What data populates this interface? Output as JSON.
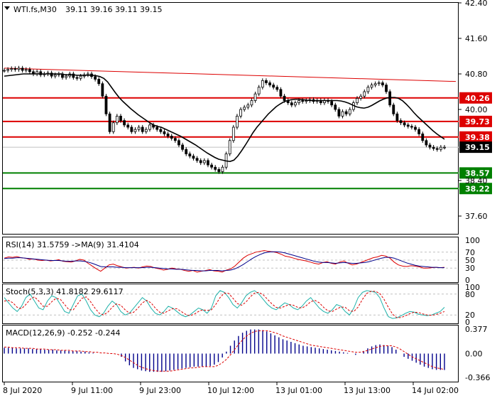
{
  "header": {
    "symbol": "WTI.fs,M30",
    "quote": "39.11 39.16 39.11 39.15"
  },
  "colors": {
    "candle": "#000000",
    "ma": "#000000",
    "resistance": "#dd0000",
    "support": "#008000",
    "current_tag": "#000000",
    "rsi": "#dd0000",
    "rsi_ma": "#00008b",
    "stoch_main": "#20b2aa",
    "stoch_signal": "#dd0000",
    "macd_hist": "#00008b",
    "macd_signal": "#dd0000"
  },
  "chart_data": [
    {
      "type": "candlestick",
      "title": "WTI.fs,M30",
      "ylim": [
        37.2,
        42.4
      ],
      "y_ticks": [
        "42.40",
        "41.60",
        "40.80",
        "40.00",
        "38.40",
        "37.60"
      ],
      "x_ticks": [
        "8 Jul 2020",
        "9 Jul 11:00",
        "9 Jul 23:00",
        "10 Jul 12:00",
        "13 Jul 01:00",
        "13 Jul 13:00",
        "14 Jul 02:00"
      ],
      "current_price": "39.15",
      "levels": {
        "resistance": [
          "40.26",
          "39.73",
          "39.38"
        ],
        "support": [
          "38.57",
          "38.22"
        ]
      },
      "trendline": {
        "from": 40.93,
        "to": 40.63
      },
      "close": [
        40.88,
        40.9,
        40.92,
        40.9,
        40.93,
        40.88,
        40.9,
        40.85,
        40.8,
        40.85,
        40.78,
        40.8,
        40.82,
        40.75,
        40.78,
        40.8,
        40.72,
        40.75,
        40.8,
        40.72,
        40.7,
        40.75,
        40.78,
        40.8,
        40.74,
        40.68,
        40.58,
        40.3,
        39.9,
        39.5,
        39.7,
        39.85,
        39.75,
        39.65,
        39.6,
        39.5,
        39.55,
        39.6,
        39.5,
        39.55,
        39.65,
        39.6,
        39.55,
        39.5,
        39.45,
        39.4,
        39.35,
        39.3,
        39.2,
        39.1,
        39.0,
        38.95,
        38.9,
        38.85,
        38.8,
        38.85,
        38.75,
        38.7,
        38.65,
        38.6,
        38.7,
        39.0,
        39.3,
        39.6,
        39.85,
        40.0,
        40.05,
        40.1,
        40.2,
        40.35,
        40.5,
        40.65,
        40.6,
        40.55,
        40.5,
        40.45,
        40.3,
        40.2,
        40.15,
        40.1,
        40.15,
        40.2,
        40.18,
        40.2,
        40.22,
        40.18,
        40.2,
        40.15,
        40.2,
        40.18,
        40.1,
        40.0,
        39.85,
        39.95,
        39.9,
        40.0,
        40.15,
        40.25,
        40.3,
        40.4,
        40.5,
        40.55,
        40.58,
        40.6,
        40.55,
        40.4,
        40.1,
        39.9,
        39.75,
        39.7,
        39.65,
        39.62,
        39.6,
        39.55,
        39.45,
        39.3,
        39.2,
        39.15,
        39.12,
        39.1,
        39.15,
        39.15
      ],
      "ma": [
        40.75,
        40.76,
        40.77,
        40.78,
        40.79,
        40.8,
        40.8,
        40.8,
        40.8,
        40.8,
        40.8,
        40.8,
        40.8,
        40.8,
        40.8,
        40.8,
        40.78,
        40.78,
        40.78,
        40.77,
        40.77,
        40.77,
        40.77,
        40.77,
        40.76,
        40.74,
        40.7,
        40.62,
        40.5,
        40.38,
        40.27,
        40.18,
        40.1,
        40.02,
        39.95,
        39.88,
        39.82,
        39.76,
        39.7,
        39.65,
        39.62,
        39.6,
        39.56,
        39.52,
        39.48,
        39.44,
        39.4,
        39.35,
        39.3,
        39.25,
        39.2,
        39.14,
        39.08,
        39.02,
        38.97,
        38.92,
        38.88,
        38.86,
        38.84,
        38.83,
        38.86,
        38.95,
        39.07,
        39.2,
        39.34,
        39.48,
        39.6,
        39.7,
        39.8,
        39.9,
        39.98,
        40.06,
        40.12,
        40.17,
        40.2,
        40.22,
        40.23,
        40.23,
        40.22,
        40.21,
        40.2,
        40.2,
        40.2,
        40.2,
        40.2,
        40.2,
        40.2,
        40.2,
        40.19,
        40.17,
        40.14,
        40.1,
        40.06,
        40.04,
        40.03,
        40.05,
        40.09,
        40.14,
        40.19,
        40.23,
        40.26,
        40.27,
        40.27,
        40.25,
        40.2,
        40.12,
        40.03,
        39.93,
        39.84,
        39.76,
        39.68,
        39.6,
        39.52,
        39.45,
        39.39,
        39.33
      ]
    },
    {
      "type": "line",
      "title": "RSI(14) 31.5759 ->MA(9) 31.4104",
      "ylim": [
        0,
        100
      ],
      "y_ticks": [
        "100",
        "70",
        "50",
        "30",
        "0"
      ],
      "series": [
        {
          "name": "RSI(14)",
          "values": [
            55,
            58,
            57,
            59,
            56,
            55,
            52,
            53,
            50,
            49,
            50,
            48,
            49,
            51,
            47,
            46,
            45,
            48,
            52,
            50,
            42,
            35,
            28,
            22,
            30,
            38,
            40,
            36,
            33,
            30,
            31,
            32,
            30,
            33,
            35,
            34,
            30,
            28,
            25,
            27,
            30,
            28,
            27,
            24,
            22,
            24,
            20,
            22,
            24,
            26,
            23,
            22,
            20,
            25,
            28,
            35,
            45,
            55,
            62,
            66,
            70,
            72,
            74,
            72,
            71,
            69,
            65,
            60,
            58,
            55,
            52,
            50,
            48,
            45,
            42,
            40,
            44,
            46,
            42,
            40,
            45,
            48,
            42,
            38,
            40,
            44,
            48,
            52,
            56,
            58,
            62,
            60,
            55,
            45,
            38,
            35,
            34,
            36,
            35,
            33,
            30,
            30,
            31,
            32,
            31,
            32
          ]
        },
        {
          "name": "MA(9)",
          "values": [
            54,
            55,
            55,
            56,
            56,
            55,
            54,
            53,
            52,
            51,
            50,
            49,
            49,
            49,
            48,
            47,
            47,
            48,
            48,
            47,
            45,
            42,
            38,
            34,
            33,
            33,
            33,
            32,
            32,
            31,
            31,
            31,
            31,
            31,
            32,
            32,
            31,
            30,
            29,
            28,
            28,
            27,
            27,
            26,
            25,
            24,
            24,
            23,
            23,
            24,
            24,
            24,
            23,
            24,
            25,
            28,
            33,
            39,
            46,
            53,
            59,
            64,
            68,
            70,
            71,
            71,
            70,
            68,
            65,
            62,
            59,
            56,
            53,
            50,
            47,
            45,
            44,
            44,
            43,
            42,
            43,
            44,
            43,
            42,
            42,
            43,
            44,
            46,
            49,
            52,
            55,
            57,
            57,
            55,
            51,
            47,
            43,
            40,
            37,
            35,
            34,
            33,
            32,
            32,
            31,
            31
          ]
        }
      ]
    },
    {
      "type": "line",
      "title": "Stoch(5,3,3) 41.8182 29.6117",
      "ylim": [
        0,
        100
      ],
      "y_ticks": [
        "100",
        "80",
        "20",
        "0"
      ],
      "series": [
        {
          "name": "Main",
          "values": [
            70,
            55,
            40,
            30,
            45,
            70,
            80,
            60,
            40,
            35,
            60,
            75,
            70,
            50,
            30,
            25,
            50,
            75,
            80,
            60,
            35,
            20,
            15,
            25,
            45,
            60,
            50,
            30,
            20,
            25,
            40,
            55,
            70,
            60,
            40,
            25,
            20,
            30,
            45,
            40,
            30,
            20,
            15,
            20,
            30,
            40,
            35,
            25,
            40,
            75,
            90,
            85,
            70,
            50,
            40,
            55,
            75,
            85,
            90,
            80,
            65,
            50,
            40,
            35,
            45,
            55,
            50,
            40,
            35,
            45,
            60,
            70,
            55,
            40,
            30,
            25,
            35,
            50,
            45,
            30,
            20,
            40,
            70,
            85,
            90,
            88,
            85,
            70,
            40,
            15,
            10,
            12,
            18,
            25,
            30,
            28,
            22,
            20,
            18,
            20,
            25,
            30,
            42
          ]
        },
        {
          "name": "Signal",
          "values": [
            60,
            62,
            55,
            42,
            38,
            50,
            65,
            72,
            60,
            45,
            45,
            58,
            68,
            65,
            50,
            35,
            35,
            52,
            68,
            72,
            58,
            40,
            25,
            20,
            28,
            42,
            52,
            48,
            35,
            25,
            28,
            40,
            55,
            62,
            55,
            40,
            28,
            25,
            32,
            38,
            38,
            30,
            22,
            18,
            22,
            30,
            35,
            33,
            35,
            50,
            70,
            83,
            82,
            68,
            53,
            48,
            57,
            72,
            83,
            85,
            78,
            65,
            52,
            42,
            40,
            45,
            50,
            48,
            42,
            40,
            47,
            58,
            62,
            55,
            42,
            32,
            30,
            37,
            43,
            42,
            32,
            30,
            43,
            65,
            82,
            88,
            88,
            82,
            65,
            42,
            22,
            12,
            13,
            18,
            24,
            28,
            27,
            23,
            20,
            19,
            21,
            25,
            30
          ]
        }
      ]
    },
    {
      "type": "bar",
      "title": "MACD(12,26,9) -0.252 -0.244",
      "ylim": [
        -0.42,
        0.42
      ],
      "y_ticks": [
        "0.377",
        "0.00",
        "-0.366"
      ],
      "series": [
        {
          "name": "MACD(12,26,9)",
          "values": [
            0.09,
            0.09,
            0.09,
            0.08,
            0.08,
            0.08,
            0.08,
            0.07,
            0.07,
            0.07,
            0.06,
            0.06,
            0.06,
            0.05,
            0.05,
            0.05,
            0.04,
            0.04,
            0.04,
            0.03,
            0.03,
            0.02,
            0.01,
            0.0,
            0.0,
            0.0,
            0.0,
            0.0,
            0.0,
            -0.05,
            -0.12,
            -0.18,
            -0.22,
            -0.24,
            -0.26,
            -0.27,
            -0.28,
            -0.28,
            -0.28,
            -0.28,
            -0.27,
            -0.26,
            -0.25,
            -0.24,
            -0.23,
            -0.22,
            -0.21,
            -0.2,
            -0.2,
            -0.2,
            -0.2,
            -0.19,
            -0.17,
            -0.13,
            -0.06,
            0.03,
            0.12,
            0.2,
            0.27,
            0.32,
            0.35,
            0.37,
            0.37,
            0.37,
            0.36,
            0.34,
            0.31,
            0.28,
            0.25,
            0.22,
            0.2,
            0.18,
            0.16,
            0.14,
            0.12,
            0.11,
            0.1,
            0.09,
            0.08,
            0.07,
            0.06,
            0.05,
            0.04,
            0.03,
            0.02,
            0.01,
            0.0,
            -0.02,
            0.0,
            0.04,
            0.08,
            0.11,
            0.13,
            0.14,
            0.13,
            0.12,
            0.1,
            0.06,
            0.0,
            -0.05,
            -0.08,
            -0.11,
            -0.14,
            -0.17,
            -0.2,
            -0.22,
            -0.24,
            -0.25,
            -0.25,
            -0.252
          ]
        },
        {
          "name": "Signal",
          "values": [
            0.1,
            0.1,
            0.09,
            0.09,
            0.09,
            0.08,
            0.08,
            0.08,
            0.07,
            0.07,
            0.07,
            0.06,
            0.06,
            0.06,
            0.05,
            0.05,
            0.05,
            0.04,
            0.04,
            0.04,
            0.03,
            0.03,
            0.02,
            0.02,
            0.01,
            0.01,
            0.0,
            0.0,
            -0.01,
            -0.03,
            -0.06,
            -0.1,
            -0.14,
            -0.18,
            -0.21,
            -0.23,
            -0.25,
            -0.26,
            -0.27,
            -0.27,
            -0.27,
            -0.27,
            -0.26,
            -0.25,
            -0.24,
            -0.23,
            -0.22,
            -0.22,
            -0.21,
            -0.2,
            -0.2,
            -0.2,
            -0.2,
            -0.18,
            -0.14,
            -0.09,
            -0.02,
            0.06,
            0.14,
            0.21,
            0.27,
            0.31,
            0.34,
            0.35,
            0.35,
            0.35,
            0.34,
            0.32,
            0.3,
            0.27,
            0.25,
            0.23,
            0.21,
            0.19,
            0.17,
            0.15,
            0.13,
            0.12,
            0.11,
            0.1,
            0.09,
            0.08,
            0.07,
            0.06,
            0.05,
            0.04,
            0.03,
            0.02,
            0.02,
            0.03,
            0.05,
            0.07,
            0.09,
            0.11,
            0.12,
            0.12,
            0.12,
            0.1,
            0.07,
            0.03,
            -0.01,
            -0.05,
            -0.08,
            -0.11,
            -0.14,
            -0.17,
            -0.2,
            -0.22,
            -0.23,
            -0.244
          ]
        }
      ]
    }
  ]
}
